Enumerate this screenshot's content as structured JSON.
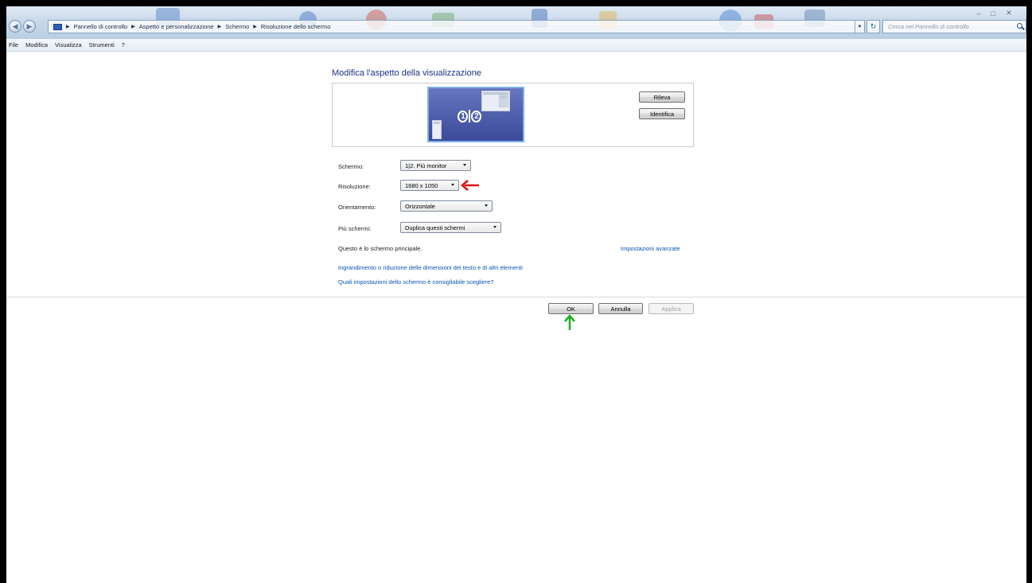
{
  "window": {
    "address_breadcrumbs": [
      "Pannello di controllo",
      "Aspetto e personalizzazione",
      "Schermo",
      "Risoluzione dello schermo"
    ],
    "search_placeholder": "Cerca nel Pannello di controllo",
    "controls": {
      "minimize": "–",
      "maximize": "□",
      "close": "✕"
    }
  },
  "menu": {
    "items": [
      "File",
      "Modifica",
      "Visualizza",
      "Strumenti",
      "?"
    ]
  },
  "main": {
    "title": "Modifica l'aspetto della visualizzazione",
    "preview": {
      "monitor_label_1": "1",
      "monitor_label_2": "2"
    },
    "buttons": {
      "detect": "Rileva",
      "identify": "Identifica"
    },
    "fields": {
      "screen": {
        "label": "Schermo:",
        "value": "1|2. Più monitor"
      },
      "resolution": {
        "label": "Risoluzione:",
        "value": "1680 x 1050"
      },
      "orientation": {
        "label": "Orientamento:",
        "value": "Orizzontale"
      },
      "multiple_displays": {
        "label": "Più schermi:",
        "value": "Duplica questi schermi"
      }
    },
    "primary_note": "Questo è lo schermo principale.",
    "advanced_link": "Impostazioni avanzate",
    "links": {
      "resize_text": "Ingrandimento o riduzione delle dimensioni del testo e di altri elementi",
      "which_settings": "Quali impostazioni dello schermo è consigliabile scegliere?"
    }
  },
  "footer": {
    "ok": "OK",
    "cancel": "Annulla",
    "apply": "Applica"
  },
  "colors": {
    "annotation_red": "#e01010",
    "annotation_green": "#18b018",
    "link_blue": "#0a55b5",
    "heading_blue": "#1e3287"
  },
  "icons": [
    "back-icon",
    "forward-icon",
    "control-panel-icon",
    "refresh-icon",
    "search-icon",
    "red-arrow-icon",
    "green-arrow-icon"
  ]
}
